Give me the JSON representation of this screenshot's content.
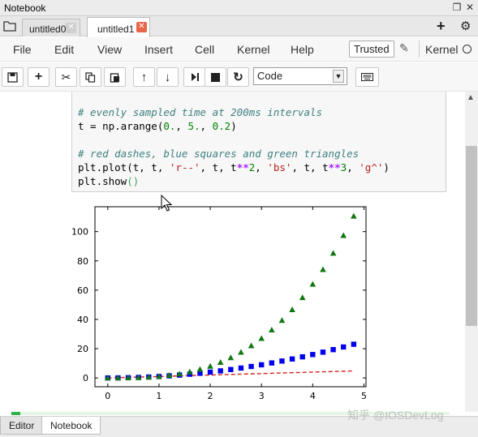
{
  "window": {
    "title": "Notebook"
  },
  "tabs": [
    {
      "label": "untitled0"
    },
    {
      "label": "untitled1"
    }
  ],
  "menu": {
    "items": [
      "File",
      "Edit",
      "View",
      "Insert",
      "Cell",
      "Kernel",
      "Help"
    ],
    "trusted_label": "Trusted",
    "kernel_label": "Kernel"
  },
  "toolbar": {
    "cell_type": "Code"
  },
  "cell": {
    "lines": [
      {
        "text": "# evenly sampled time at 200ms intervals"
      },
      {
        "text": "t = np.arange(0., 5., 0.2)"
      },
      {
        "text": "# red dashes, blue squares and green triangles"
      },
      {
        "text": "plt.plot(t, t, 'r--', t, t**2, 'bs', t, t**3, 'g^')"
      },
      {
        "text": "plt.show()"
      }
    ]
  },
  "chart_data": {
    "type": "line",
    "title": "",
    "xlabel": "",
    "ylabel": "",
    "xlim": [
      -0.25,
      5.04
    ],
    "ylim": [
      -6,
      117
    ],
    "xticks": [
      0,
      1,
      2,
      3,
      4,
      5
    ],
    "yticks": [
      0,
      20,
      40,
      60,
      80,
      100
    ],
    "x": [
      0.0,
      0.2,
      0.4,
      0.6,
      0.8,
      1.0,
      1.2,
      1.4,
      1.6,
      1.8,
      2.0,
      2.2,
      2.4,
      2.6,
      2.8,
      3.0,
      3.2,
      3.4,
      3.6,
      3.8,
      4.0,
      4.2,
      4.4,
      4.6,
      4.8
    ],
    "series": [
      {
        "style": "r--",
        "color": "#d62020",
        "marker": "dashed-line",
        "values": [
          0.0,
          0.2,
          0.4,
          0.6,
          0.8,
          1.0,
          1.2,
          1.4,
          1.6,
          1.8,
          2.0,
          2.2,
          2.4,
          2.6,
          2.8,
          3.0,
          3.2,
          3.4,
          3.6,
          3.8,
          4.0,
          4.2,
          4.4,
          4.6,
          4.8
        ]
      },
      {
        "style": "bs",
        "color": "#0000ee",
        "marker": "square",
        "values": [
          0.0,
          0.04,
          0.16,
          0.36,
          0.64,
          1.0,
          1.44,
          1.96,
          2.56,
          3.24,
          4.0,
          4.84,
          5.76,
          6.76,
          7.84,
          9.0,
          10.24,
          11.56,
          12.96,
          14.44,
          16.0,
          17.64,
          19.36,
          21.16,
          23.04
        ]
      },
      {
        "style": "g^",
        "color": "#117711",
        "marker": "triangle",
        "values": [
          0.0,
          0.008,
          0.064,
          0.216,
          0.512,
          1.0,
          1.728,
          2.744,
          4.096,
          5.832,
          8.0,
          10.648,
          13.824,
          17.576,
          21.952,
          27.0,
          32.768,
          39.304,
          46.656,
          54.872,
          64.0,
          74.088,
          85.184,
          97.336,
          110.592
        ]
      }
    ]
  },
  "progress": {
    "fraction": 0.02
  },
  "bottom_tabs": [
    "Editor",
    "Notebook"
  ],
  "watermark": "知乎 @IOSDevLog",
  "colors": {
    "tab_close_active": "#e8664a",
    "progress": "#2db34a",
    "comment": "#408080",
    "string": "#ba2121"
  }
}
